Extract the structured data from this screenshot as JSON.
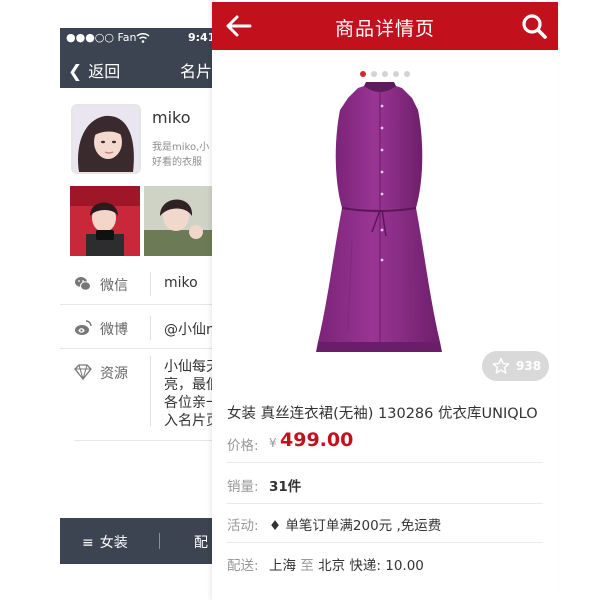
{
  "back_card": {
    "status_bar": {
      "carrier": "●●●○○ Fan",
      "time": "9:41"
    },
    "nav": {
      "back_label": "返回",
      "title": "名片"
    },
    "profile": {
      "name": "miko",
      "bio_line1": "我是miko,小",
      "bio_line2": "好看的衣服"
    },
    "rows": [
      {
        "icon": "wechat-icon",
        "label": "微信",
        "value": "miko"
      },
      {
        "icon": "weibo-icon",
        "label": "微博",
        "value": "@小仙n"
      }
    ],
    "resource": {
      "label": "资源",
      "lines": [
        "小仙每天",
        "亮，最低",
        "各位亲一",
        "入名片页"
      ]
    },
    "bottom_tab": {
      "menu_label": "女装",
      "next_label": "配"
    }
  },
  "product_page": {
    "header": {
      "title": "商品详情页"
    },
    "carousel": {
      "count": 5,
      "active_index": 0
    },
    "favorite_count": "938",
    "title": "女装 真丝连衣裙(无袖) 130286 优衣库UNIQLO",
    "price": {
      "label": "价格:",
      "currency": "¥",
      "value": "499.00"
    },
    "sales": {
      "label": "销量:",
      "value": "31件"
    },
    "promo": {
      "label": "活动:",
      "value": "♦ 单笔订单满200元 ,免运费"
    },
    "shipping": {
      "label": "配送:",
      "from": "上海",
      "to_word": "至",
      "to": "北京",
      "method": "快递: 10.00"
    },
    "colors": {
      "header": "#c2111c",
      "price": "#c2111c",
      "dress": "#8b2a86",
      "active_dot": "#d7262e"
    }
  }
}
